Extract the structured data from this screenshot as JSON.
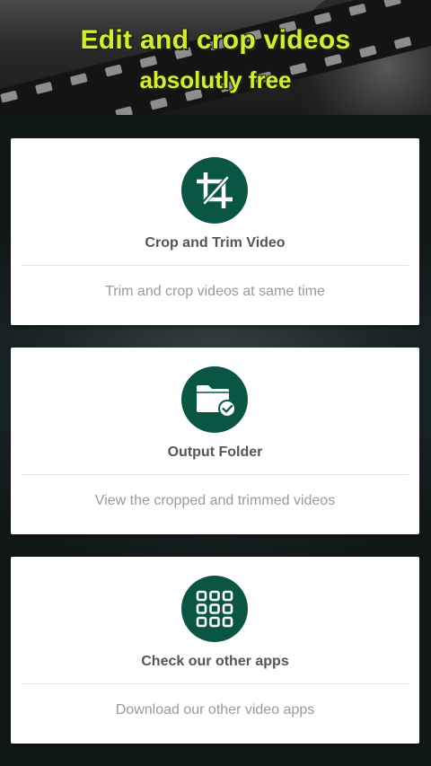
{
  "banner": {
    "title_line1": "Edit and crop videos",
    "title_line2": "absolutly free",
    "text_color": "#d7ea3c"
  },
  "cards": [
    {
      "icon": "crop-icon",
      "title": "Crop and Trim Video",
      "description": "Trim and crop videos at same time"
    },
    {
      "icon": "folder-check-icon",
      "title": "Output Folder",
      "description": "View the cropped and trimmed videos"
    },
    {
      "icon": "apps-grid-icon",
      "title": "Check our other apps",
      "description": "Download our other video apps"
    }
  ],
  "colors": {
    "icon_circle": "#0b5545",
    "card_background": "#ffffff",
    "title_text": "#555555",
    "description_text": "#9a9a9a"
  }
}
